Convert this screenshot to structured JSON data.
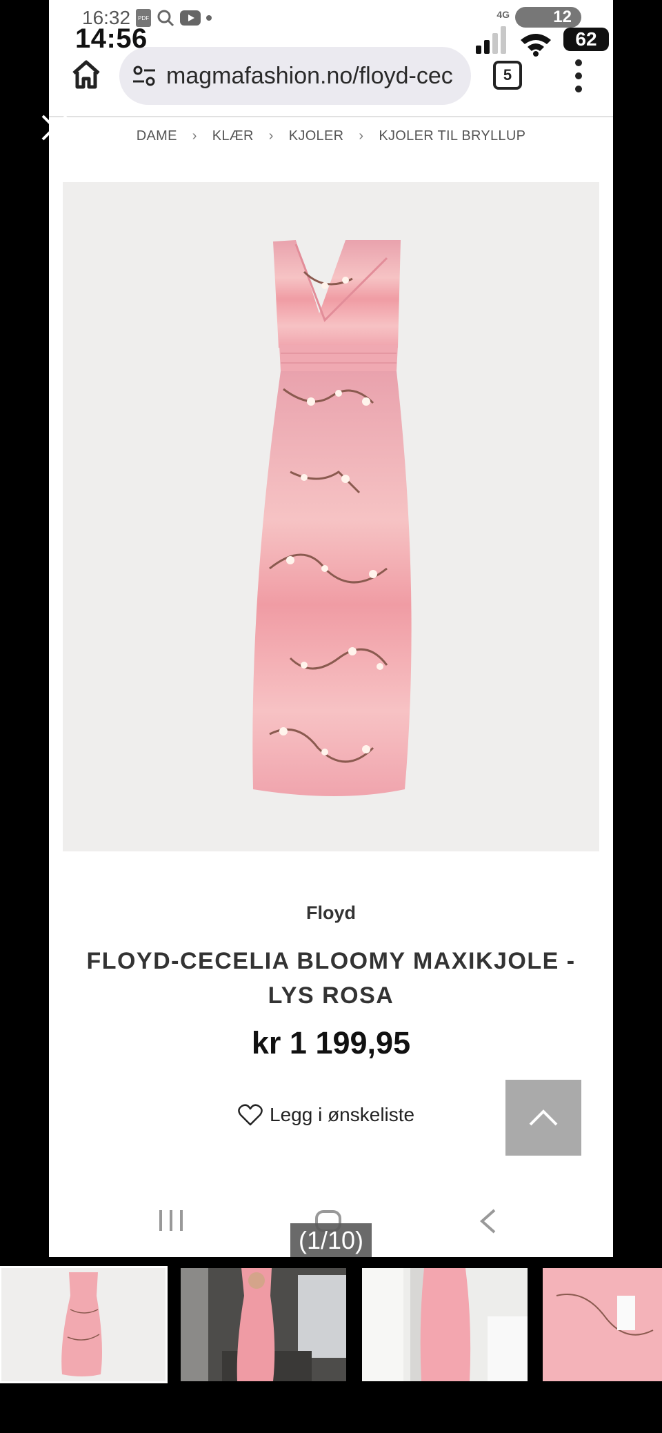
{
  "status": {
    "back_time": "16:32",
    "front_time": "14:56",
    "network": "4G",
    "back_battery": "12",
    "front_battery": "62"
  },
  "browser": {
    "url": "magmafashion.no/floyd-cec",
    "tab_count": "5"
  },
  "breadcrumb": [
    "DAME",
    "KLÆR",
    "KJOLER",
    "KJOLER TIL BRYLLUP"
  ],
  "product": {
    "brand": "Floyd",
    "title_line1": "FLOYD-CECELIA BLOOMY MAXIKJOLE -",
    "title_line2": "LYS ROSA",
    "price": "kr 1 199,95",
    "wishlist_label": "Legg i ønskeliste"
  },
  "gallery": {
    "counter": "(1/10)"
  },
  "colors": {
    "dress_pink": "#f2a9b0",
    "image_bg": "#efeeed",
    "to_top_bg": "#aaaaaa"
  }
}
